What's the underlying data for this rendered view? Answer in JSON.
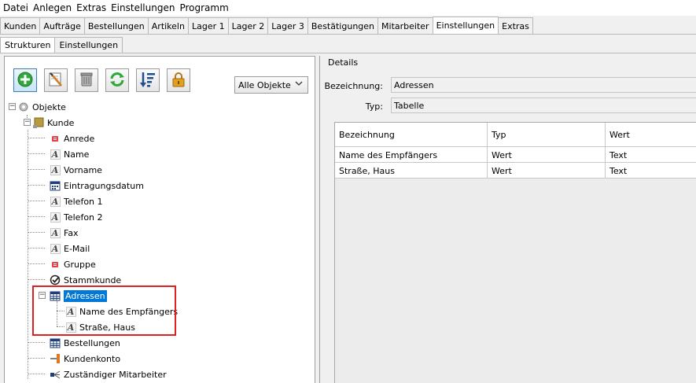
{
  "menu": [
    "Datei",
    "Anlegen",
    "Extras",
    "Einstellungen",
    "Programm"
  ],
  "tabs": [
    "Kunden",
    "Aufträge",
    "Bestellungen",
    "Artikeln",
    "Lager 1",
    "Lager 2",
    "Lager 3",
    "Bestätigungen",
    "Mitarbeiter",
    "Einstellungen",
    "Extras"
  ],
  "active_tab": "Einstellungen",
  "subtabs": [
    "Strukturen",
    "Einstellungen"
  ],
  "active_subtab": "Strukturen",
  "toolbar": {
    "buttons": [
      "add-icon",
      "edit-icon",
      "trash-icon",
      "refresh-icon",
      "sort-icon",
      "lock-icon"
    ],
    "filter_value": "Alle Objekte",
    "colors": {
      "add": "#2fa83a",
      "refresh": "#2fa83a",
      "lock": "#e0a020",
      "sort": "#1f4f8f"
    }
  },
  "tree": {
    "root": "Objekte",
    "kunde": "Kunde",
    "fields": {
      "anrede": "Anrede",
      "name": "Name",
      "vorname": "Vorname",
      "eintragungsdatum": "Eintragungsdatum",
      "telefon1": "Telefon 1",
      "telefon2": "Telefon 2",
      "fax": "Fax",
      "email": "E-Mail",
      "gruppe": "Gruppe",
      "stammkunde": "Stammkunde",
      "adressen": "Adressen",
      "adressen_name": "Name des Empfängers",
      "adressen_strasse": "Straße, Haus",
      "bestellungen": "Bestellungen",
      "kundenkonto": "Kundenkonto",
      "mitarbeiter": "Zuständiger Mitarbeiter"
    }
  },
  "details": {
    "title": "Details",
    "bezeichnung_label": "Bezeichnung:",
    "bezeichnung_value": "Adressen",
    "typ_label": "Typ:",
    "typ_value": "Tabelle",
    "grid": {
      "headers": [
        "Bezeichnung",
        "Typ",
        "Wert"
      ],
      "rows": [
        [
          "Name des Empfängers",
          "Wert",
          "Text"
        ],
        [
          "Straße, Haus",
          "Wert",
          "Text"
        ]
      ]
    }
  }
}
